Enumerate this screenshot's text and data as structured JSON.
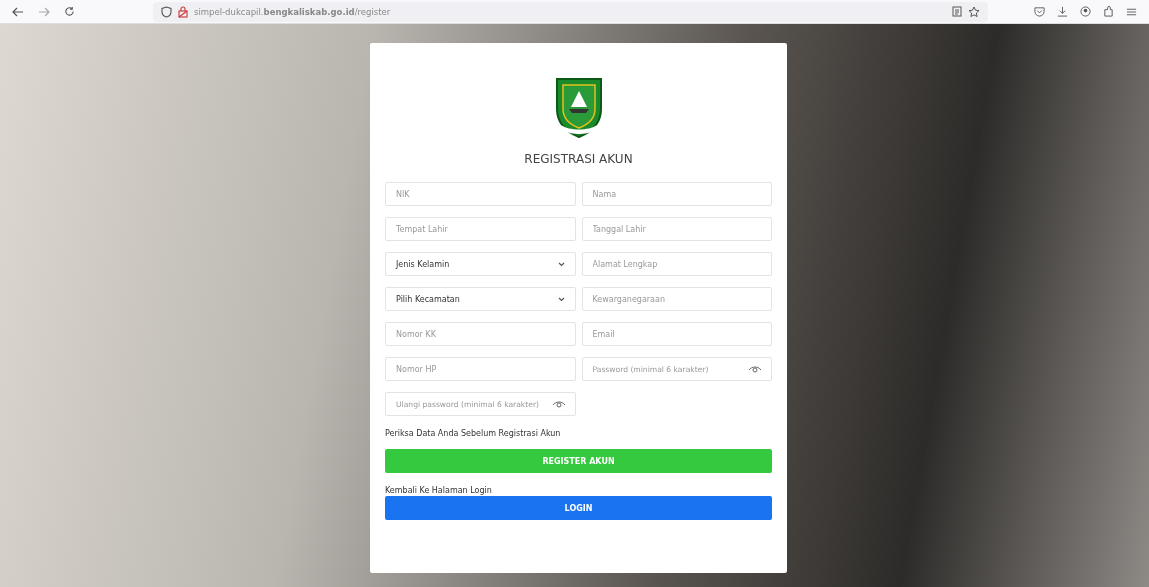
{
  "browser": {
    "address": "simpel-dukcapil.**bengkaliskab.go.id**/register"
  },
  "form": {
    "title": "REGISTRASI AKUN",
    "fields": [
      {
        "kind": "text",
        "placeholder": "NIK"
      },
      {
        "kind": "text",
        "placeholder": "Nama"
      },
      {
        "kind": "text",
        "placeholder": "Tempat Lahir"
      },
      {
        "kind": "text",
        "placeholder": "Tanggal Lahir"
      },
      {
        "kind": "select",
        "value": "Jenis Kelamin"
      },
      {
        "kind": "text",
        "placeholder": "Alamat Lengkap"
      },
      {
        "kind": "select",
        "value": "Pilih Kecamatan"
      },
      {
        "kind": "text",
        "placeholder": "Kewarganegaraan"
      },
      {
        "kind": "text",
        "placeholder": "Nomor KK"
      },
      {
        "kind": "text",
        "placeholder": "Email"
      },
      {
        "kind": "text",
        "placeholder": "Nomor HP"
      },
      {
        "kind": "password",
        "placeholder": "Password (minimal 6 karakter)"
      },
      {
        "kind": "password",
        "placeholder": "Ulangi password (minimal 6 karakter)"
      }
    ],
    "note": "Periksa Data Anda Sebelum Registrasi Akun",
    "register_button": "REGISTER AKUN",
    "login_hint": "Kembali Ke Halaman Login",
    "login_button": "LOGIN"
  }
}
